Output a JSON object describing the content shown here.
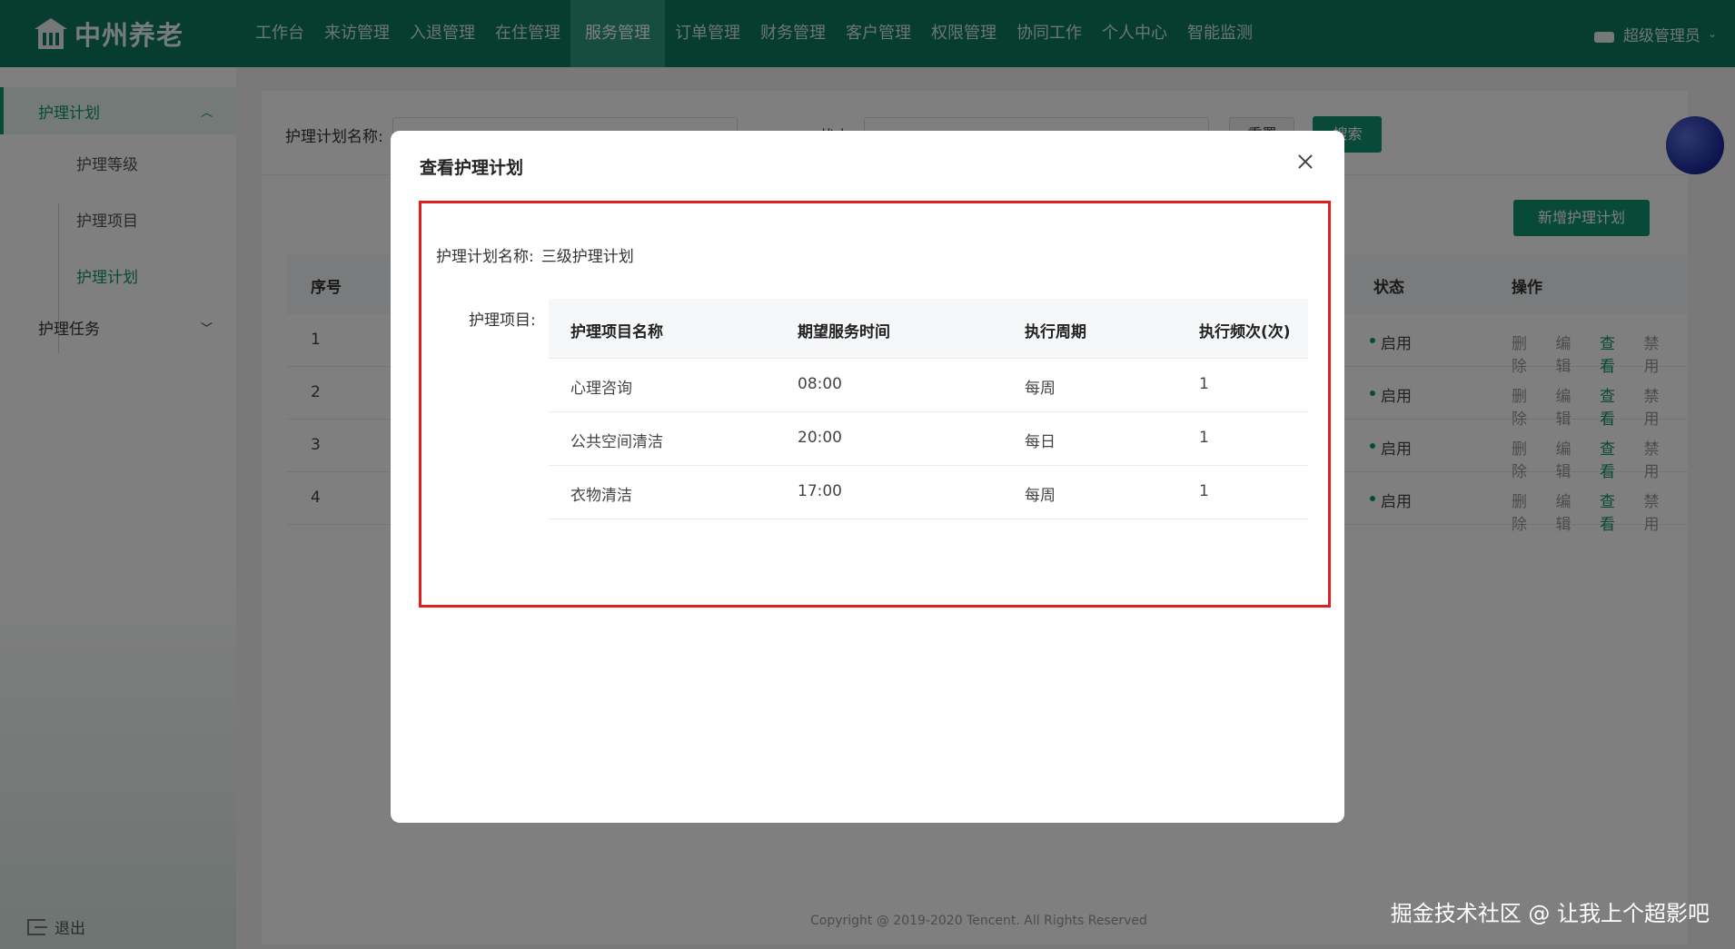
{
  "app": {
    "logo_text": "中州养老"
  },
  "nav": {
    "items": [
      {
        "label": "工作台"
      },
      {
        "label": "来访管理"
      },
      {
        "label": "入退管理"
      },
      {
        "label": "在住管理"
      },
      {
        "label": "服务管理",
        "active": true
      },
      {
        "label": "订单管理"
      },
      {
        "label": "财务管理"
      },
      {
        "label": "客户管理"
      },
      {
        "label": "权限管理"
      },
      {
        "label": "协同工作"
      },
      {
        "label": "个人中心"
      },
      {
        "label": "智能监测"
      }
    ]
  },
  "user": {
    "name": "超级管理员"
  },
  "sidebar": {
    "group1": "护理计划",
    "items": [
      {
        "label": "护理等级"
      },
      {
        "label": "护理项目"
      },
      {
        "label": "护理计划",
        "active": true
      }
    ],
    "group2": "护理任务",
    "logout": "退出"
  },
  "filter": {
    "name_label": "护理计划名称:",
    "status_label": "状态:",
    "reset_label": "重置",
    "search_label": "搜索"
  },
  "add_button": "新增护理计划",
  "table": {
    "headers": {
      "index": "序号",
      "status": "状态",
      "ops": "操作"
    },
    "rows": [
      {
        "index": "1",
        "status": "启用"
      },
      {
        "index": "2",
        "status": "启用"
      },
      {
        "index": "3",
        "status": "启用"
      },
      {
        "index": "4",
        "status": "启用"
      }
    ],
    "ops": {
      "delete": "删除",
      "edit": "编辑",
      "view": "查看",
      "disable": "禁用"
    }
  },
  "copyright": "Copyright @ 2019-2020 Tencent. All Rights Reserved",
  "modal": {
    "title": "查看护理计划",
    "plan_name_label": "护理计划名称:",
    "plan_name_value": "三级护理计划",
    "items_label": "护理项目:",
    "items_headers": [
      "护理项目名称",
      "期望服务时间",
      "执行周期",
      "执行频次(次)"
    ],
    "items_rows": [
      [
        "心理咨询",
        "08:00",
        "每周",
        "1"
      ],
      [
        "公共空间清洁",
        "20:00",
        "每日",
        "1"
      ],
      [
        "衣物清洁",
        "17:00",
        "每周",
        "1"
      ]
    ]
  },
  "watermark": "掘金技术社区 @ 让我上个超影吧",
  "colors": {
    "primary": "#13926f",
    "header": "#0d7a5f",
    "highlight": "#e02020"
  }
}
